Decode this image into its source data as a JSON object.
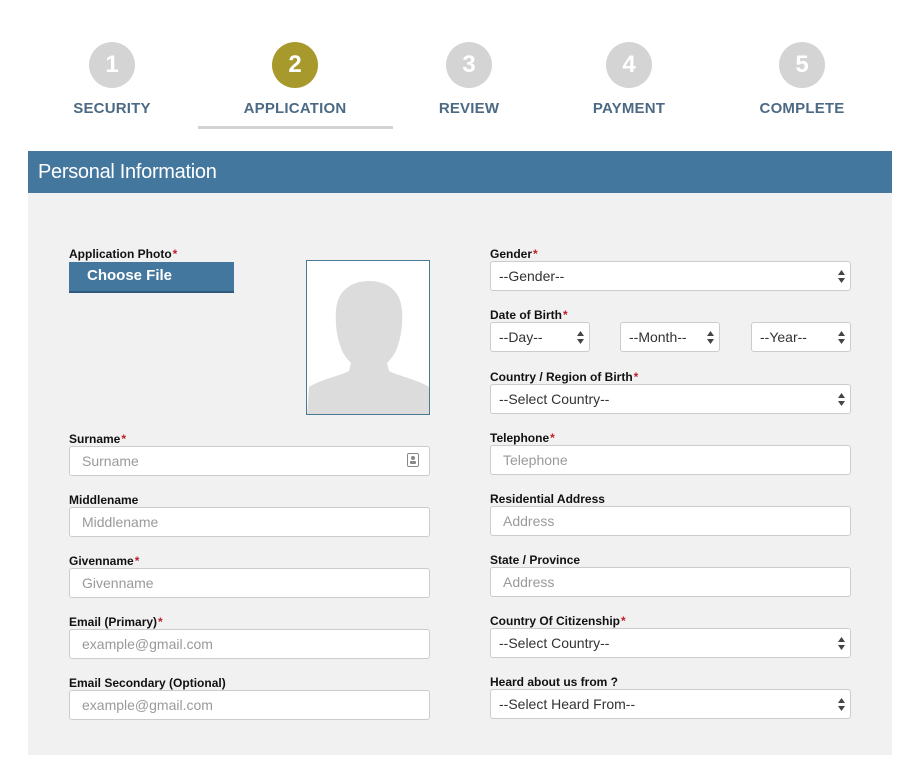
{
  "steps": [
    {
      "number": "1",
      "label": "SECURITY"
    },
    {
      "number": "2",
      "label": "APPLICATION"
    },
    {
      "number": "3",
      "label": "REVIEW"
    },
    {
      "number": "4",
      "label": "PAYMENT"
    },
    {
      "number": "5",
      "label": "COMPLETE"
    }
  ],
  "active_step": "APPLICATION",
  "section": {
    "title": "Personal Information"
  },
  "photo": {
    "label": "Application Photo",
    "button_label": "Choose File"
  },
  "left_fields": {
    "surname": {
      "label": "Surname",
      "placeholder": "Surname"
    },
    "middlename": {
      "label": "Middlename",
      "placeholder": "Middlename"
    },
    "givenname": {
      "label": "Givenname",
      "placeholder": "Givenname"
    },
    "email_primary": {
      "label": "Email (Primary)",
      "placeholder": "example@gmail.com"
    },
    "email_secondary": {
      "label": "Email Secondary (Optional)",
      "placeholder": "example@gmail.com"
    }
  },
  "right_fields": {
    "gender": {
      "label": "Gender",
      "value": "--Gender--"
    },
    "dob": {
      "label": "Date of Birth",
      "day": "--Day--",
      "month": "--Month--",
      "year": "--Year--"
    },
    "birth_country": {
      "label": "Country / Region of Birth",
      "value": "--Select Country--"
    },
    "telephone": {
      "label": "Telephone",
      "placeholder": "Telephone"
    },
    "residential_address": {
      "label": "Residential Address",
      "placeholder": "Address"
    },
    "state": {
      "label": "State / Province",
      "placeholder": "Address"
    },
    "citizenship": {
      "label": "Country Of Citizenship",
      "value": "--Select Country--"
    },
    "heard_from": {
      "label": "Heard about us from ?",
      "value": "--Select Heard From--"
    }
  },
  "required_marker": "*",
  "colors": {
    "accent_blue": "#44779e",
    "active_step": "#a8992c",
    "inactive_step": "#d4d4d4",
    "required": "#c0202a"
  },
  "icons": {
    "photo_placeholder": "person-silhouette-icon",
    "select_arrows": "up-down-arrows-icon",
    "contact_card": "contact-card-icon"
  }
}
